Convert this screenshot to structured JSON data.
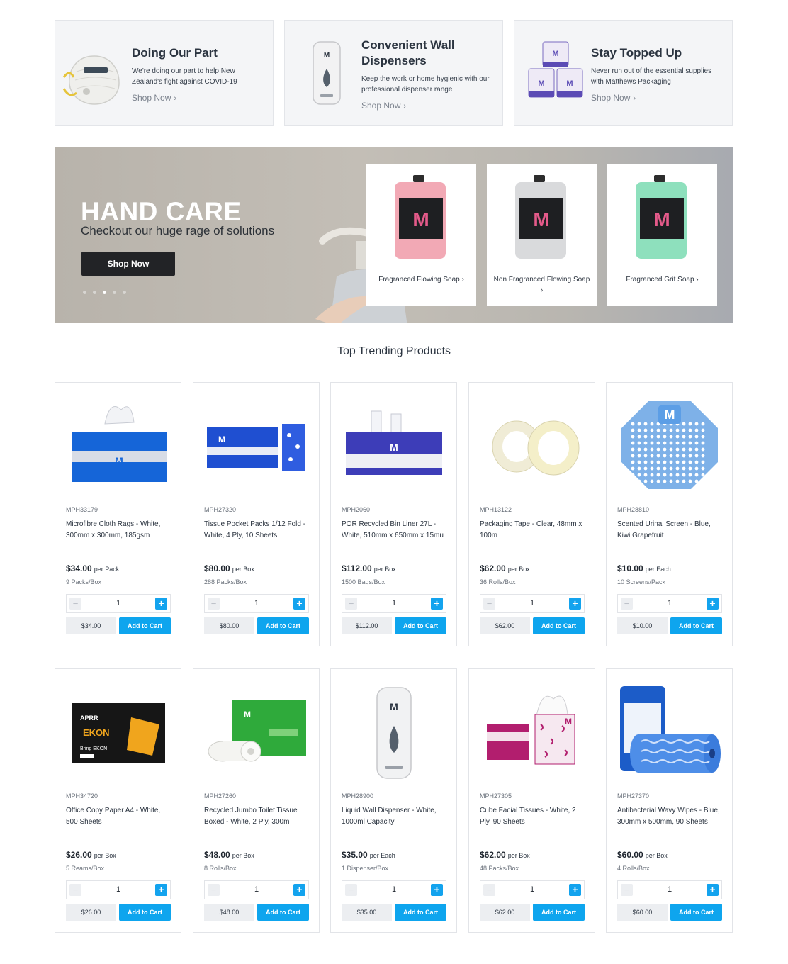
{
  "promos": [
    {
      "title": "Doing Our Part",
      "text": "We're doing our part to help New Zealand's fight against COVID-19",
      "link": "Shop Now",
      "icon": "face-mask-icon"
    },
    {
      "title": "Convenient Wall Dispensers",
      "text": "Keep the work or home hygienic with our professional dispenser range",
      "link": "Shop Now",
      "icon": "wall-dispenser-icon"
    },
    {
      "title": "Stay Topped Up",
      "text": "Never run out of the essential supplies with Matthews Packaging",
      "link": "Shop Now",
      "icon": "toilet-rolls-icon"
    }
  ],
  "hero": {
    "title": "HAND CARE",
    "subtitle": "Checkout our huge rage of solutions",
    "button": "Shop Now",
    "slides": 5,
    "active_slide": 3,
    "cards": [
      {
        "label": "Fragranced Flowing Soap",
        "color": "#f2a9b5"
      },
      {
        "label": "Non Fragranced Flowing Soap",
        "color": "#d9dadc"
      },
      {
        "label": "Fragranced Grit Soap",
        "color": "#8ee0bd"
      }
    ]
  },
  "section_title": "Top Trending Products",
  "products": [
    {
      "sku": "MPH33179",
      "name": "Microfibre Cloth Rags - White, 300mm x 300mm, 185gsm",
      "price": "$34.00",
      "per": "per Pack",
      "pack": "9 Packs/Box",
      "qty": "1",
      "total": "$34.00",
      "cta": "Add to Cart"
    },
    {
      "sku": "MPH27320",
      "name": "Tissue Pocket Packs 1/12 Fold - White, 4 Ply, 10 Sheets",
      "price": "$80.00",
      "per": "per Box",
      "pack": "288 Packs/Box",
      "qty": "1",
      "total": "$80.00",
      "cta": "Add to Cart"
    },
    {
      "sku": "MPH2060",
      "name": "POR Recycled Bin Liner 27L - White, 510mm x 650mm x 15mu",
      "price": "$112.00",
      "per": "per Box",
      "pack": "1500 Bags/Box",
      "qty": "1",
      "total": "$112.00",
      "cta": "Add to Cart"
    },
    {
      "sku": "MPH13122",
      "name": "Packaging Tape - Clear, 48mm x 100m",
      "price": "$62.00",
      "per": "per Box",
      "pack": "36 Rolls/Box",
      "qty": "1",
      "total": "$62.00",
      "cta": "Add to Cart"
    },
    {
      "sku": "MPH28810",
      "name": "Scented Urinal Screen - Blue, Kiwi Grapefruit",
      "price": "$10.00",
      "per": "per Each",
      "pack": "10 Screens/Pack",
      "qty": "1",
      "total": "$10.00",
      "cta": "Add to Cart"
    },
    {
      "sku": "MPH34720",
      "name": "Office Copy Paper A4 - White, 500 Sheets",
      "price": "$26.00",
      "per": "per Box",
      "pack": "5 Reams/Box",
      "qty": "1",
      "total": "$26.00",
      "cta": "Add to Cart"
    },
    {
      "sku": "MPH27260",
      "name": "Recycled Jumbo Toilet Tissue Boxed - White, 2 Ply, 300m",
      "price": "$48.00",
      "per": "per Box",
      "pack": "8 Rolls/Box",
      "qty": "1",
      "total": "$48.00",
      "cta": "Add to Cart"
    },
    {
      "sku": "MPH28900",
      "name": "Liquid Wall Dispenser - White, 1000ml Capacity",
      "price": "$35.00",
      "per": "per Each",
      "pack": "1 Dispenser/Box",
      "qty": "1",
      "total": "$35.00",
      "cta": "Add to Cart"
    },
    {
      "sku": "MPH27305",
      "name": "Cube Facial Tissues - White, 2 Ply, 90 Sheets",
      "price": "$62.00",
      "per": "per Box",
      "pack": "48 Packs/Box",
      "qty": "1",
      "total": "$62.00",
      "cta": "Add to Cart"
    },
    {
      "sku": "MPH27370",
      "name": "Antibacterial Wavy Wipes - Blue, 300mm x 500mm, 90 Sheets",
      "price": "$60.00",
      "per": "per Box",
      "pack": "4 Rolls/Box",
      "qty": "1",
      "total": "$60.00",
      "cta": "Add to Cart"
    }
  ],
  "product_images": [
    "microfibre-box-icon",
    "tissue-pocket-packs-icon",
    "bin-liner-box-icon",
    "packaging-tape-icon",
    "urinal-screen-icon",
    "copy-paper-box-icon",
    "jumbo-toilet-tissue-icon",
    "wall-dispenser-icon",
    "cube-tissues-icon",
    "wavy-wipes-roll-icon"
  ],
  "colors": {
    "accent": "#0ea5ee",
    "dark_button": "#222326"
  }
}
